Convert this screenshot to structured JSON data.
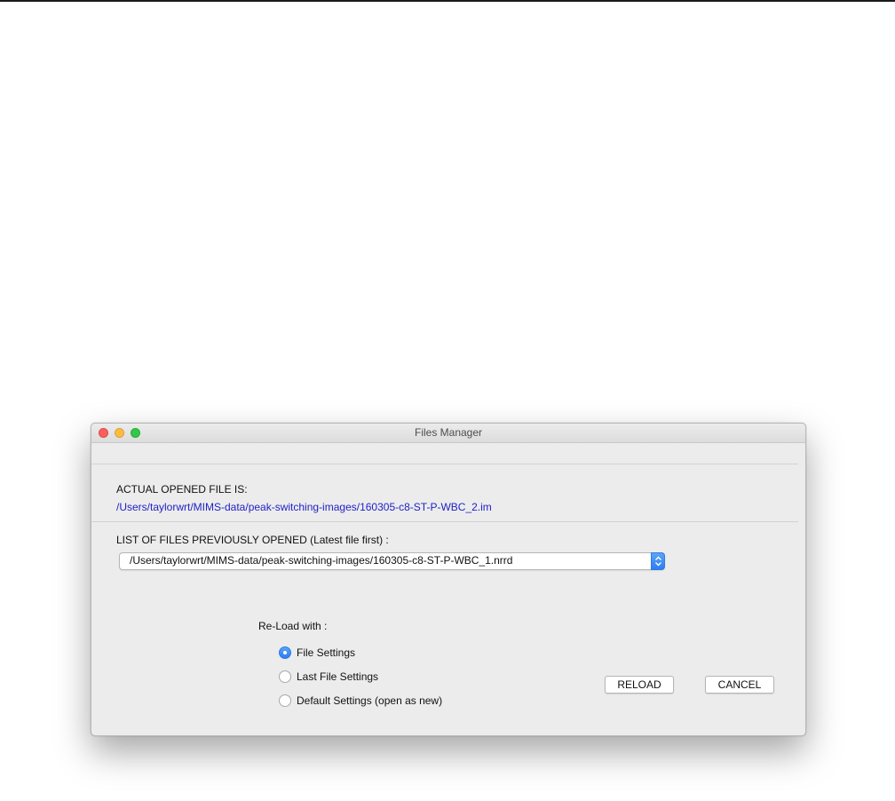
{
  "window": {
    "title": "Files Manager"
  },
  "actual_file": {
    "label": "ACTUAL OPENED FILE IS:",
    "path": "/Users/taylorwrt/MIMS-data/peak-switching-images/160305-c8-ST-P-WBC_2.im"
  },
  "previous_files": {
    "label": "LIST OF FILES PREVIOUSLY OPENED (Latest file first) :",
    "selected": "/Users/taylorwrt/MIMS-data/peak-switching-images/160305-c8-ST-P-WBC_1.nrrd"
  },
  "reload_options": {
    "label": "Re-Load with :",
    "options": [
      {
        "label": "File Settings",
        "checked": true
      },
      {
        "label": "Last File Settings",
        "checked": false
      },
      {
        "label": "Default Settings (open as new)",
        "checked": false
      }
    ]
  },
  "buttons": {
    "reload": "RELOAD",
    "cancel": "CANCEL"
  },
  "icons": {
    "close": "close-traffic-light",
    "minimize": "minimize-traffic-light",
    "maximize": "maximize-traffic-light",
    "combo": "chevron-updown-icon"
  },
  "colors": {
    "accent": "#2d7ef0",
    "path_link": "#2121c8",
    "window_bg": "#ececec",
    "close": "#fc605c",
    "minimize": "#fdbc40",
    "maximize": "#34c84a"
  }
}
